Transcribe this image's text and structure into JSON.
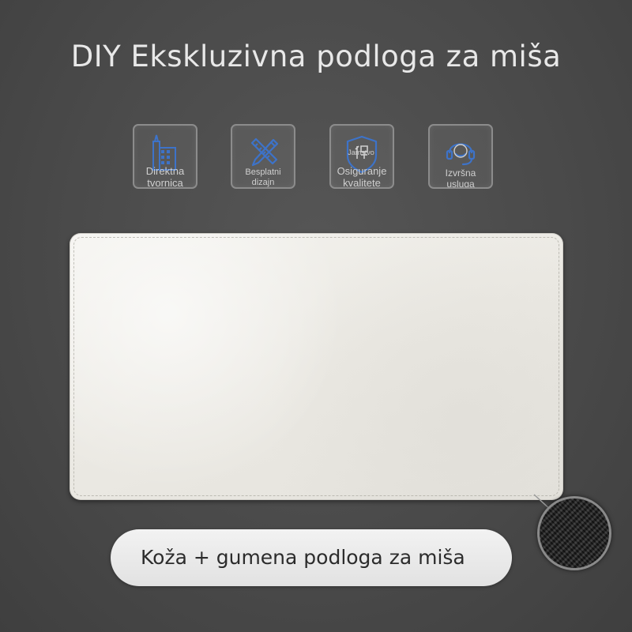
{
  "title": "DIY Ekskluzivna podloga za miša",
  "features": [
    {
      "icon": "factory-icon",
      "label_lines": [
        "Direktna",
        "tvornica"
      ]
    },
    {
      "icon": "pencil-ruler-icon",
      "label_lines": [
        "Besplatni",
        "dizajn"
      ]
    },
    {
      "icon": "shield-guarantee-icon",
      "badge": "Jamstvo",
      "label_lines": [
        "Osiguranje",
        "kvalitete"
      ]
    },
    {
      "icon": "headset-support-icon",
      "label_lines": [
        "Izvršna",
        "usluga"
      ]
    }
  ],
  "product": {
    "description": "Koža + gumena podloga za miša"
  },
  "colors": {
    "background": "#4a4a4a",
    "icon_accent": "#3d73c9",
    "pad_surface": "#efede8",
    "pill_background": "#ececec"
  }
}
